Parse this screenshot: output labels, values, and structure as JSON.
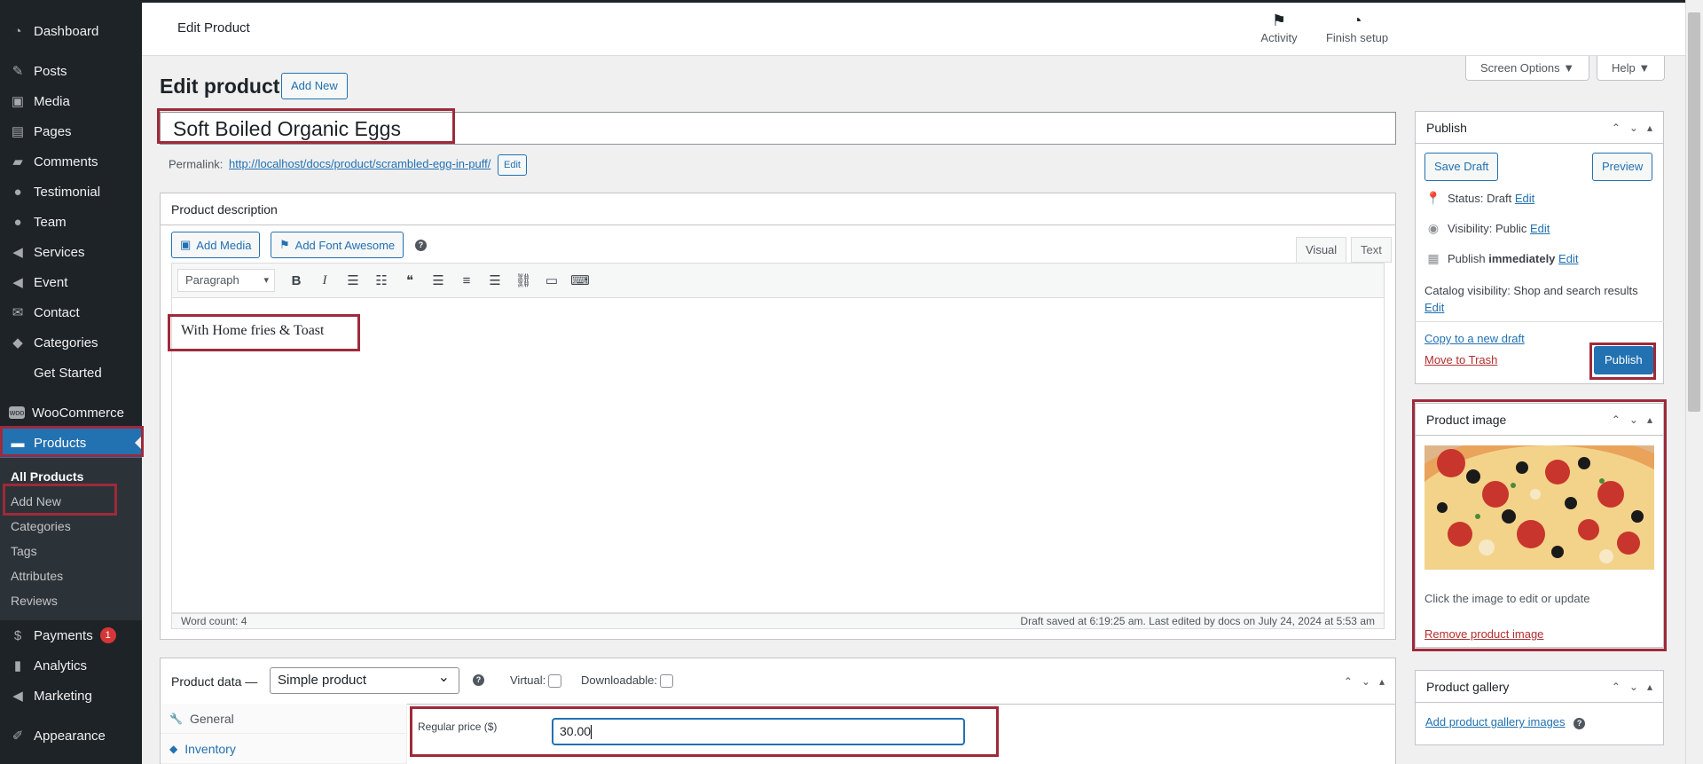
{
  "sidebar": {
    "items": [
      {
        "label": "Dashboard",
        "icon": "dashboard-icon"
      },
      {
        "label": "Posts",
        "icon": "pin-icon"
      },
      {
        "label": "Media",
        "icon": "media-icon"
      },
      {
        "label": "Pages",
        "icon": "pages-icon"
      },
      {
        "label": "Comments",
        "icon": "comment-icon"
      },
      {
        "label": "Testimonial",
        "icon": "user-icon"
      },
      {
        "label": "Team",
        "icon": "user-icon"
      },
      {
        "label": "Services",
        "icon": "megaphone-icon"
      },
      {
        "label": "Event",
        "icon": "megaphone-icon"
      },
      {
        "label": "Contact",
        "icon": "mail-icon"
      },
      {
        "label": "Categories",
        "icon": "tag-icon"
      },
      {
        "label": "Get Started",
        "icon": ""
      },
      {
        "label": "WooCommerce",
        "icon": "woo-icon"
      },
      {
        "label": "Products",
        "icon": "archive-icon"
      },
      {
        "label": "Payments",
        "icon": "dollar-icon",
        "badge": "1"
      },
      {
        "label": "Analytics",
        "icon": "chart-icon"
      },
      {
        "label": "Marketing",
        "icon": "megaphone-icon"
      },
      {
        "label": "Appearance",
        "icon": "brush-icon"
      }
    ],
    "submenu": [
      "All Products",
      "Add New",
      "Categories",
      "Tags",
      "Attributes",
      "Reviews"
    ]
  },
  "header": {
    "page_label": "Edit Product",
    "activity": "Activity",
    "finish_setup": "Finish setup",
    "screen_options": "Screen Options ▼",
    "help": "Help ▼"
  },
  "main": {
    "heading": "Edit product",
    "add_new": "Add New",
    "title_value": "Soft Boiled Organic Eggs",
    "permalink_label": "Permalink:",
    "permalink_url": "http://localhost/docs/product/scrambled-egg-in-puff/",
    "permalink_edit": "Edit"
  },
  "description": {
    "title": "Product description",
    "add_media": "Add Media",
    "add_font_awesome": "Add Font Awesome",
    "help": "?",
    "tab_visual": "Visual",
    "tab_text": "Text",
    "format": "Paragraph",
    "content": "With Home fries & Toast",
    "word_count": "Word count: 4",
    "draft_status": "Draft saved at 6:19:25 am. Last edited by docs on July 24, 2024 at 5:53 am"
  },
  "product_data": {
    "title": "Product data —",
    "type": "Simple product",
    "help": "?",
    "virtual": "Virtual:",
    "downloadable": "Downloadable:",
    "tabs": [
      "General",
      "Inventory"
    ],
    "regular_price_label": "Regular price ($)",
    "regular_price_value": "30.00"
  },
  "publish": {
    "title": "Publish",
    "save_draft": "Save Draft",
    "preview": "Preview",
    "status_label": "Status:",
    "status_value": "Draft",
    "visibility_label": "Visibility:",
    "visibility_value": "Public",
    "publish_label": "Publish",
    "publish_value": "immediately",
    "edit": "Edit",
    "catalog_visibility": "Catalog visibility: Shop and search results",
    "copy_draft": "Copy to a new draft",
    "move_trash": "Move to Trash",
    "publish_button": "Publish"
  },
  "product_image": {
    "title": "Product image",
    "hint": "Click the image to edit or update",
    "remove": "Remove product image"
  },
  "product_gallery": {
    "title": "Product gallery",
    "add": "Add product gallery images"
  },
  "colors": {
    "admin_dark": "#1d2327",
    "accent": "#2271b1",
    "highlight_border": "#9e2a3a"
  }
}
